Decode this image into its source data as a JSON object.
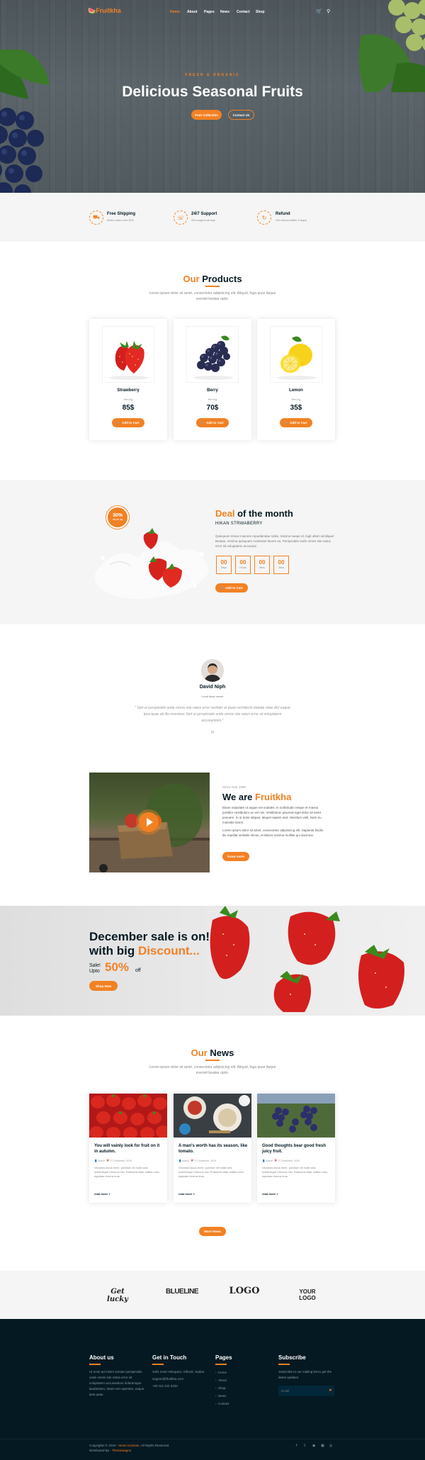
{
  "brand": {
    "name": "Fruitkha",
    "tagline": "FRESH & ORGANIC FRUITS"
  },
  "nav": {
    "items": [
      "Home",
      "About",
      "Pages",
      "News",
      "Contact",
      "Shop"
    ],
    "active": "Home"
  },
  "hero": {
    "subtitle": "FRESH & ORGANIC",
    "title": "Delicious Seasonal Fruits",
    "primary_button": "Fruit Collection",
    "secondary_button": "Contact Us"
  },
  "features": [
    {
      "icon": "truck-icon",
      "title": "Free Shipping",
      "text": "When order over $75"
    },
    {
      "icon": "phone-icon",
      "title": "24/7 Support",
      "text": "Get support all day"
    },
    {
      "icon": "refresh-icon",
      "title": "Refund",
      "text": "Get refund within 3 days!"
    }
  ],
  "products_section": {
    "title_accent": "Our",
    "title_rest": "Products",
    "description": "Lorem ipsum dolor sit amet, consectetur adipisicing elit. Aliquid, fuga quas itaque eveniet beatae optio."
  },
  "products": [
    {
      "name": "Strawberry",
      "unit": "Per Kg",
      "price": "85$",
      "button": "Add to Cart"
    },
    {
      "name": "Berry",
      "unit": "Per Kg",
      "price": "70$",
      "button": "Add to Cart"
    },
    {
      "name": "Lemon",
      "unit": "Per Kg",
      "price": "35$",
      "button": "Add to Cart"
    }
  ],
  "deal": {
    "badge_value": "30%",
    "badge_label": "off per kg",
    "title_accent": "Deal",
    "title_rest": "of the month",
    "product": "HIKAN STRWABERRY",
    "description": "Quisquam minus maiores repudiandae nobis, minima saepe id, fugit ullam similique! Beatae, minima quisquam molestias facere ea. Perspiciatis unde omnis iste natus error sit voluptatem accusant",
    "countdown": [
      {
        "value": "00",
        "label": "Days"
      },
      {
        "value": "00",
        "label": "Hours"
      },
      {
        "value": "00",
        "label": "Mins"
      },
      {
        "value": "00",
        "label": "Secs"
      }
    ],
    "button": "Add to Cart"
  },
  "testimonial": {
    "name": "David Niph",
    "role": "Local shop owner",
    "quote": "\" Sed ut perspiciatis unde omnis iste natus error veritatis et quasi architecto beatae vitae dict eaque ipsa quae ab illo inventore Sed ut perspiciatis unde omnis iste natus error sit voluptatem accusantium \"",
    "quote_mark": "”"
  },
  "about": {
    "since": "Since Year 1999",
    "title_lead": "We are",
    "title_accent": "Fruitkha",
    "paragraph1": "Etiam vulputate ut augue vel sodales. In sollicitudin neque et massa porttitor vestibulum ac vel nisi. Vestibulum placerat eget dolor sit amet posuere. In ut dolor aliquet, aliquet sapien sed, interdum velit. Nam eu molestie lorem.",
    "paragraph2": "Lorem ipsum dolor sit amet, consectetur adipisicing elit. Sapiente facilis illo repellat veritatis minus, et labore minima mollitia qui ducimus.",
    "button": "know more"
  },
  "sale": {
    "line1": "December sale is on!",
    "line2_lead": "with big",
    "line2_accent": "Discount...",
    "small1": "Sale!",
    "small2": "Upto",
    "percent": "50%",
    "off": "off",
    "button": "Shop Now"
  },
  "news_section": {
    "title_accent": "Our",
    "title_rest": "News",
    "description": "Lorem ipsum dolor sit amet, consectetur adipisicing elit. Aliquid, fuga quas itaque eveniet beatae optio.",
    "more_button": "More News"
  },
  "news": [
    {
      "title": "You will vainly look for fruit on it in autumn.",
      "author": "Admin",
      "date": "27 December, 2019",
      "excerpt": "Vivamus lacus enim, pulvinar vel nulla sed, scelerisque rhoncus nisi. Praesent vitae mattis nunc, egestas viverra eros.",
      "more": "read more >"
    },
    {
      "title": "A man's worth has its season, like tomato.",
      "author": "Admin",
      "date": "27 December, 2019",
      "excerpt": "Vivamus lacus enim, pulvinar vel nulla sed, scelerisque rhoncus nisi. Praesent vitae mattis nunc, egestas viverra eros.",
      "more": "read more >"
    },
    {
      "title": "Good thoughts bear good fresh juicy fruit.",
      "author": "Admin",
      "date": "27 December, 2019",
      "excerpt": "Vivamus lacus enim, pulvinar vel nulla sed, scelerisque rhoncus nisi. Praesent vitae mattis nunc, egestas viverra eros.",
      "more": "read more >"
    }
  ],
  "brands": [
    "Get lucky",
    "BLUELINE",
    "LOGO",
    "YOUR LOGO"
  ],
  "footer": {
    "about_title": "About us",
    "about_text": "Ut enim ad minim veniam perspiciatis unde omnis iste natus error sit voluptatem accusantium doloremque laudantium, totam rem aperiam, eaque ipsa quae.",
    "contact_title": "Get in Touch",
    "contact_lines": [
      "34/8, East Hukupara, Gifirtok, Sadan.",
      "support@fruitkha.com",
      "+00 111 222 3333"
    ],
    "pages_title": "Pages",
    "pages": [
      "Home",
      "About",
      "Shop",
      "News",
      "Contact"
    ],
    "subscribe_title": "Subscribe",
    "subscribe_text": "Subscribe to our mailing list to get the latest updates.",
    "email_placeholder": "Email",
    "copyright_lead": "Copyrights © 2019 - ",
    "copyright_name": "Imran Hossain",
    "copyright_tail": ", All Rights Reserved.",
    "distributed_lead": "Distributed By - ",
    "distributed_name": "Themewagon",
    "social": [
      "facebook-icon",
      "twitter-icon",
      "instagram-icon",
      "linkedin-icon",
      "dribbble-icon"
    ]
  },
  "colors": {
    "accent": "#F28123",
    "dark": "#051922",
    "light_bg": "#f5f5f5"
  }
}
